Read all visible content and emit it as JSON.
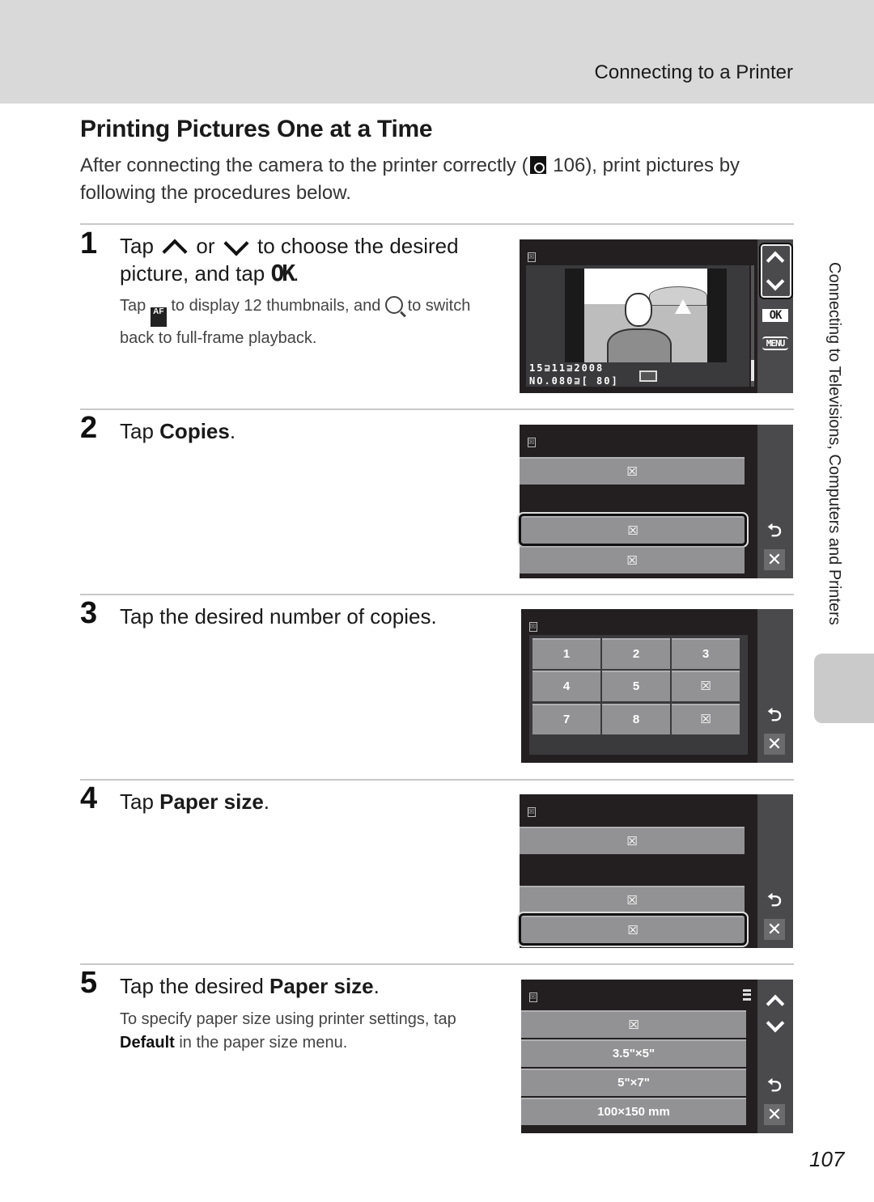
{
  "header": {
    "section_title": "Connecting to a Printer"
  },
  "page": {
    "title": "Printing Pictures One at a Time",
    "intro_before": "After connecting the camera to the printer correctly (",
    "intro_ref": "106",
    "intro_after": "), print pictures by following the procedures below.",
    "side_tab_label": "Connecting to Televisions, Computers and Printers",
    "page_number": "107"
  },
  "steps": [
    {
      "num": "1",
      "text_a": "Tap",
      "text_or": "or",
      "text_b": "to choose the desired picture, and tap",
      "text_end": ".",
      "ok_glyph": "OK",
      "sub_a": "Tap",
      "sub_b": "to display 12 thumbnails, and",
      "sub_c": "to switch back to full-frame playback.",
      "af_glyph": "AF"
    },
    {
      "num": "2",
      "text": "Tap ",
      "bold": "Copies",
      "end": "."
    },
    {
      "num": "3",
      "text": "Tap the desired number of copies."
    },
    {
      "num": "4",
      "text": "Tap ",
      "bold": "Paper size",
      "end": "."
    },
    {
      "num": "5",
      "text": "Tap the desired ",
      "bold": "Paper size",
      "end": ".",
      "sub_a": "To specify paper size using printer settings, tap ",
      "sub_bold": "Default",
      "sub_b": " in the paper size menu."
    }
  ],
  "screens": {
    "s1": {
      "date": "15⊒11⊒2008",
      "file": "NO.080⊒[   80]",
      "ok_label": "OK",
      "menu_label": "MENU",
      "scroll_position": 0.95
    },
    "s2": {
      "rows": [
        "☒",
        "☒",
        "☒"
      ],
      "selected_index": 1
    },
    "s3": {
      "cells": [
        "1",
        "2",
        "3",
        "4",
        "5",
        "☒",
        "7",
        "8",
        "☒"
      ]
    },
    "s4": {
      "rows": [
        "☒",
        "☒",
        "☒"
      ],
      "selected_index": 2
    },
    "s5": {
      "rows": [
        "☒",
        "3.5\"×5\"",
        "5\"×7\"",
        "100×150 mm"
      ]
    },
    "placeholder_glyph": "☒"
  }
}
